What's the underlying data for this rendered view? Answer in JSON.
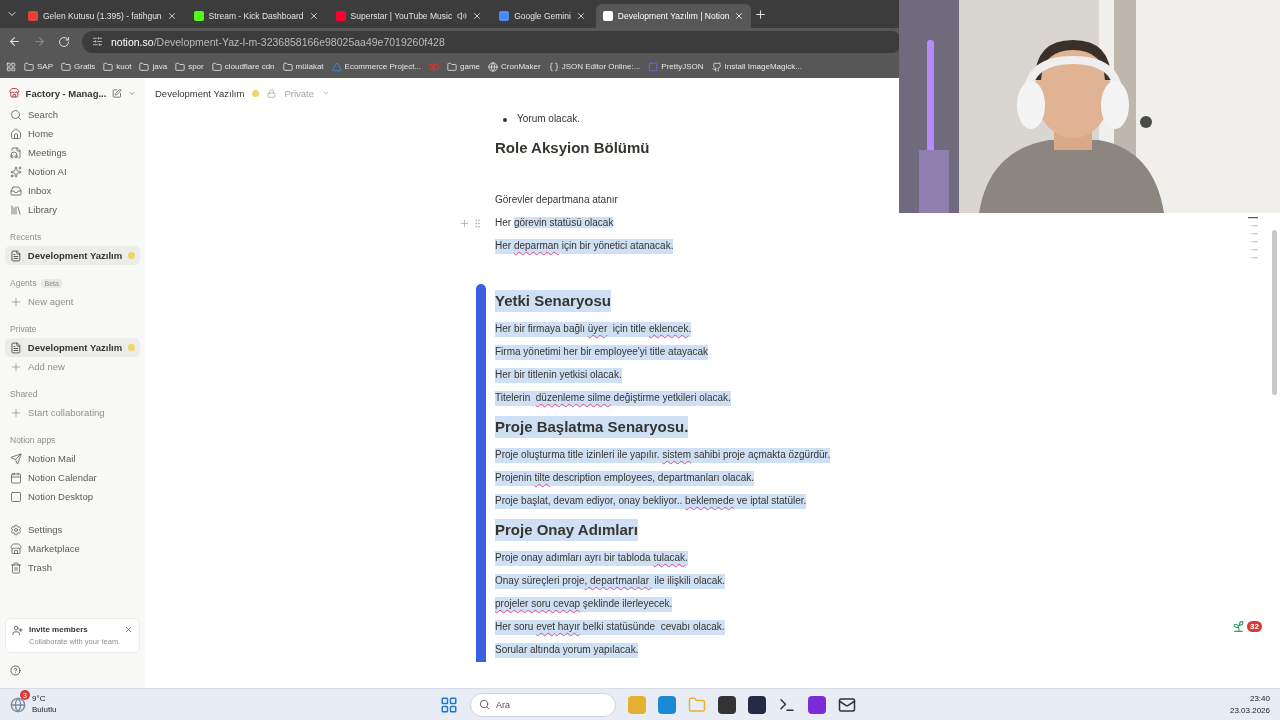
{
  "browser": {
    "tabs": [
      {
        "title": "Gelen Kutusu (1.395) - fatihgun",
        "selected": false,
        "audio": false
      },
      {
        "title": "Stream - Kick Dashboard",
        "selected": false,
        "audio": false
      },
      {
        "title": "Superstar | YouTube Music",
        "selected": false,
        "audio": true
      },
      {
        "title": "Google Gemini",
        "selected": false,
        "audio": false
      },
      {
        "title": "Development Yazılım | Notion",
        "selected": true,
        "audio": false
      }
    ],
    "address": {
      "host": "notion.so",
      "path": "/Development-Yaz-l-m-3236858166e98025aa49e7019260f428"
    },
    "bookmarks": [
      {
        "label": "SAP",
        "kind": "folder"
      },
      {
        "label": "Gratis",
        "kind": "folder"
      },
      {
        "label": "kuot",
        "kind": "folder"
      },
      {
        "label": "java",
        "kind": "folder"
      },
      {
        "label": "spor",
        "kind": "folder"
      },
      {
        "label": "cloudflare cdn",
        "kind": "folder"
      },
      {
        "label": "mülakat",
        "kind": "folder"
      },
      {
        "label": "Ecommerce Project...",
        "kind": "link"
      },
      {
        "kind": "link"
      },
      {
        "label": "game",
        "kind": "folder"
      },
      {
        "label": "CronMaker",
        "kind": "link"
      },
      {
        "label": "JSON Editor Online:...",
        "kind": "link"
      },
      {
        "label": "PrettyJSON",
        "kind": "link"
      },
      {
        "label": "Install ImageMagick...",
        "kind": "link"
      }
    ]
  },
  "sidebar": {
    "workspace": "Factory - Manag...",
    "nav": [
      {
        "label": "Search"
      },
      {
        "label": "Home"
      },
      {
        "label": "Meetings"
      },
      {
        "label": "Notion AI"
      },
      {
        "label": "Inbox"
      },
      {
        "label": "Library"
      }
    ],
    "sections": [
      {
        "heading": "Recents",
        "items": [
          {
            "label": "Development Yazılım",
            "kind": "page",
            "selected": true
          }
        ]
      },
      {
        "heading": "Agents",
        "badge": "Beta",
        "items": [
          {
            "label": "New agent",
            "kind": "add",
            "selected": false
          }
        ]
      },
      {
        "heading": "Private",
        "items": [
          {
            "label": "Development Yazılım",
            "kind": "page",
            "selected": true
          },
          {
            "label": "Add new",
            "kind": "add",
            "selected": false
          }
        ]
      },
      {
        "heading": "Shared",
        "items": [
          {
            "label": "Start collaborating",
            "kind": "add",
            "selected": false
          }
        ]
      },
      {
        "heading": "Notion apps",
        "items": [
          {
            "label": "Notion Mail",
            "kind": "mail",
            "selected": false
          },
          {
            "label": "Notion Calendar",
            "kind": "calendar",
            "selected": false
          },
          {
            "label": "Notion Desktop",
            "kind": "desktop",
            "selected": false
          }
        ]
      }
    ],
    "bottom_nav": [
      {
        "label": "Settings"
      },
      {
        "label": "Marketplace"
      },
      {
        "label": "Trash"
      }
    ],
    "invite": {
      "title": "Invite members",
      "subtitle": "Collaborate with your team."
    }
  },
  "topbar": {
    "breadcrumb": "Development Yazılım",
    "privacy": "Private"
  },
  "document": {
    "blocks": [
      {
        "kind": "bullet",
        "selected": false,
        "parts": [
          {
            "text": "Yorum olacak."
          }
        ]
      },
      {
        "kind": "heading",
        "selected": false,
        "parts": [
          {
            "text": "Role Aksyion Bölümü"
          }
        ]
      },
      {
        "kind": "paragraph",
        "selected": false,
        "parts": [
          {
            "text": "Görevler departmana atanır"
          }
        ]
      },
      {
        "kind": "paragraph",
        "hovered": true,
        "parts": [
          {
            "text": "Her ",
            "selected": false
          },
          {
            "text": "görevin statüsü olacak",
            "selected": true
          }
        ]
      },
      {
        "kind": "paragraph",
        "selected": true,
        "parts": [
          {
            "text": "Her "
          },
          {
            "text": "deparman",
            "misspelled": true
          },
          {
            "text": " için bir yönetici atanacak."
          }
        ]
      }
    ],
    "group": [
      {
        "kind": "heading",
        "selected": true,
        "parts": [
          {
            "text": "Yetki Senaryosu"
          }
        ]
      },
      {
        "kind": "paragraph",
        "selected": true,
        "parts": [
          {
            "text": "Her bir firmaya bağlı "
          },
          {
            "text": "üyer",
            "misspelled": true
          },
          {
            "text": "  için title "
          },
          {
            "text": "eklencek",
            "misspelled": true
          },
          {
            "text": "."
          }
        ]
      },
      {
        "kind": "paragraph",
        "selected": true,
        "parts": [
          {
            "text": "Firma yönetimi her bir employee'yi title atayacak"
          }
        ]
      },
      {
        "kind": "paragraph",
        "selected": true,
        "parts": [
          {
            "text": "Her bir titlenin yetkisi olacak."
          }
        ]
      },
      {
        "kind": "paragraph",
        "selected": true,
        "parts": [
          {
            "text": "Titelerin  "
          },
          {
            "text": "düzenleme",
            "misspelled": true
          },
          {
            "text": " silme",
            "misspelled": true
          },
          {
            "text": " değiştirme yetkileri olacak."
          }
        ]
      },
      {
        "kind": "heading",
        "selected": true,
        "parts": [
          {
            "text": "Proje Başlatma Senaryosu."
          }
        ]
      },
      {
        "kind": "paragraph",
        "selected": true,
        "parts": [
          {
            "text": "Proje oluşturma title izinleri ile yapılır. "
          },
          {
            "text": "sistem",
            "misspelled": true
          },
          {
            "text": " sahibi proje açmakta özgürdür."
          }
        ]
      },
      {
        "kind": "paragraph",
        "selected": true,
        "parts": [
          {
            "text": "Projenin "
          },
          {
            "text": "tilte",
            "misspelled": true
          },
          {
            "text": " description employees, departmanları olacak."
          }
        ]
      },
      {
        "kind": "paragraph",
        "selected": true,
        "parts": [
          {
            "text": "Proje başlat, devam ediyor, onay bekliyor.. "
          },
          {
            "text": "beklemede",
            "misspelled": true
          },
          {
            "text": " ve iptal statüler."
          }
        ]
      },
      {
        "kind": "heading",
        "selected": true,
        "parts": [
          {
            "text": "Proje Onay Adımları"
          }
        ]
      },
      {
        "kind": "paragraph",
        "selected": true,
        "parts": [
          {
            "text": "Proje onay adımları ayrı bir tabloda "
          },
          {
            "text": "tulacak",
            "misspelled": true
          },
          {
            "text": "."
          }
        ]
      },
      {
        "kind": "paragraph",
        "selected": true,
        "parts": [
          {
            "text": "Onay süreçleri proje"
          },
          {
            "text": ", departmanlar ",
            "misspelled": true
          },
          {
            "text": " ile ilişkili olacak."
          }
        ]
      },
      {
        "kind": "paragraph",
        "selected": true,
        "parts": [
          {
            "text": "projeler soru",
            "misspelled": true
          },
          {
            "text": " cevap",
            "misspelled": true
          },
          {
            "text": " şeklinde ilerleyecek."
          }
        ]
      },
      {
        "kind": "paragraph",
        "selected": true,
        "parts": [
          {
            "text": "Her soru "
          },
          {
            "text": "evet",
            "misspelled": true
          },
          {
            "text": " hayır",
            "misspelled": true
          },
          {
            "text": " belki statüsünde  cevabı olacak."
          }
        ]
      },
      {
        "kind": "paragraph",
        "selected": true,
        "parts": [
          {
            "text": "Sorular altında yorum yapılacak."
          }
        ]
      }
    ]
  },
  "corner_badge": {
    "count": "32"
  },
  "taskbar": {
    "weather": {
      "temp": "9°C",
      "desc": "Bulutlu",
      "badge": "3"
    },
    "search": {
      "placeholder": "Ara"
    },
    "time": "23:40",
    "date": "23.03.2026"
  }
}
